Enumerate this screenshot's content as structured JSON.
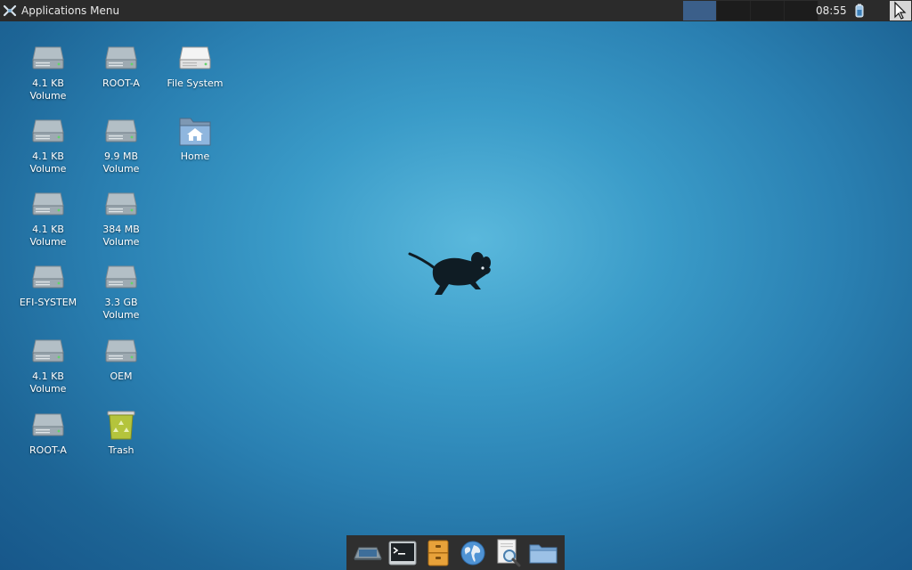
{
  "panel": {
    "apps_menu_label": "Applications Menu",
    "clock": "08:55",
    "workspaces": [
      {
        "active": true
      },
      {
        "active": false
      },
      {
        "active": false
      },
      {
        "active": false
      }
    ]
  },
  "desktop": {
    "icons": [
      {
        "label": "4.1 KB\nVolume",
        "icon": "drive-icon"
      },
      {
        "label": "4.1 KB\nVolume",
        "icon": "drive-icon"
      },
      {
        "label": "4.1 KB\nVolume",
        "icon": "drive-icon"
      },
      {
        "label": "EFI-SYSTEM",
        "icon": "drive-icon"
      },
      {
        "label": "4.1 KB\nVolume",
        "icon": "drive-icon"
      },
      {
        "label": "ROOT-A",
        "icon": "drive-icon"
      },
      {
        "label": "ROOT-A",
        "icon": "drive-icon"
      },
      {
        "label": "9.9 MB\nVolume",
        "icon": "drive-icon"
      },
      {
        "label": "384 MB\nVolume",
        "icon": "drive-icon"
      },
      {
        "label": "3.3 GB\nVolume",
        "icon": "drive-icon"
      },
      {
        "label": "OEM",
        "icon": "drive-icon"
      },
      {
        "label": "Trash",
        "icon": "trash-icon"
      },
      {
        "label": "File System",
        "icon": "filesystem-icon"
      },
      {
        "label": "Home",
        "icon": "home-folder-icon"
      }
    ]
  },
  "dock": {
    "items": [
      "show-desktop-icon",
      "terminal-icon",
      "file-manager-icon",
      "web-browser-icon",
      "app-finder-icon",
      "folder-icon"
    ]
  },
  "colors": {
    "panel_bg": "#2b2b2b",
    "active_workspace": "#3b5f8a",
    "wallpaper_center": "#5ab8dc",
    "wallpaper_edge": "#17578a"
  }
}
